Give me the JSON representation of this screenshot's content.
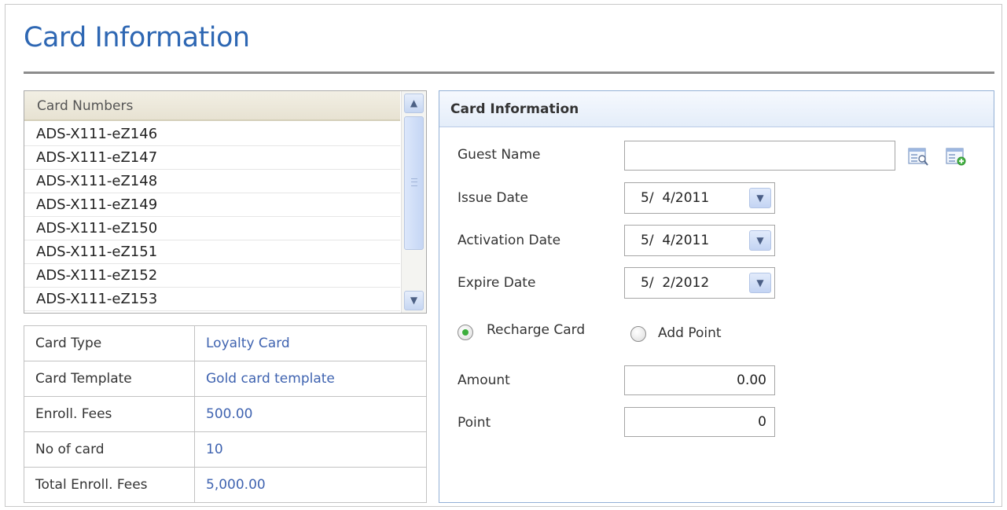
{
  "page": {
    "title": "Card Information"
  },
  "card_list": {
    "header": "Card Numbers",
    "items": [
      "ADS-X111-eZ146",
      "ADS-X111-eZ147",
      "ADS-X111-eZ148",
      "ADS-X111-eZ149",
      "ADS-X111-eZ150",
      "ADS-X111-eZ151",
      "ADS-X111-eZ152",
      "ADS-X111-eZ153"
    ]
  },
  "details": {
    "rows": [
      {
        "label": "Card Type",
        "value": "Loyalty Card"
      },
      {
        "label": "Card Template",
        "value": "Gold card template"
      },
      {
        "label": "Enroll. Fees",
        "value": "500.00"
      },
      {
        "label": "No of card",
        "value": "10"
      },
      {
        "label": "Total Enroll. Fees",
        "value": "5,000.00"
      }
    ]
  },
  "form": {
    "header": "Card Information",
    "guest_name": {
      "label": "Guest Name",
      "value": ""
    },
    "issue_date": {
      "label": "Issue Date",
      "value": "5/  4/2011"
    },
    "activation_date": {
      "label": "Activation Date",
      "value": "5/  4/2011"
    },
    "expire_date": {
      "label": "Expire Date",
      "value": "5/  2/2012"
    },
    "mode": {
      "recharge_label": "Recharge Card",
      "add_point_label": "Add Point",
      "selected": "recharge"
    },
    "amount": {
      "label": "Amount",
      "value": "0.00"
    },
    "point": {
      "label": "Point",
      "value": "0"
    }
  },
  "colors": {
    "title": "#2e67b3",
    "link_value": "#3f63b0",
    "radio_selected": "#3cae3c",
    "panel_border": "#93b0d6"
  },
  "icons": [
    "search-record-icon",
    "add-record-icon",
    "chevron-down-icon",
    "chevron-up-icon"
  ]
}
